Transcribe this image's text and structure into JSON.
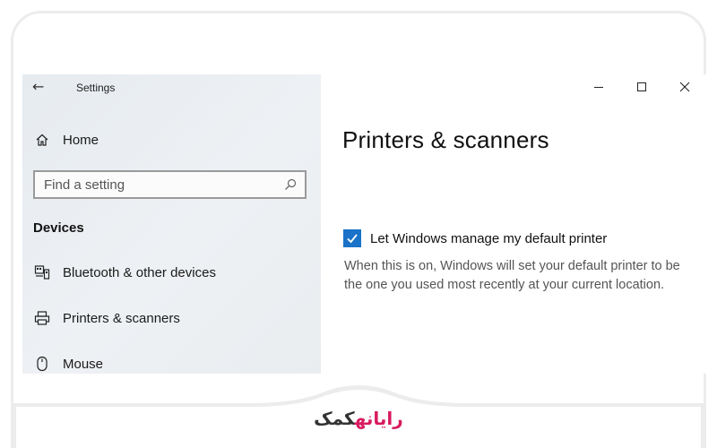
{
  "window": {
    "title": "Settings",
    "back_glyph": "←",
    "controls": [
      "minimize-icon",
      "maximize-icon",
      "close-icon"
    ]
  },
  "sidebar": {
    "home_label": "Home",
    "search_placeholder": "Find a setting",
    "section_title": "Devices",
    "items": [
      {
        "label": "Bluetooth & other devices",
        "icon": "bluetooth-devices-icon"
      },
      {
        "label": "Printers & scanners",
        "icon": "printer-icon"
      },
      {
        "label": "Mouse",
        "icon": "mouse-icon"
      }
    ]
  },
  "main": {
    "title": "Printers & scanners",
    "checkbox_label": "Let Windows manage my default printer",
    "checkbox_checked": true,
    "description": "When this is on, Windows will set your default printer to be the one you used most recently at your current location."
  },
  "brand": {
    "part1": "رایانه",
    "part2": "کمک"
  },
  "colors": {
    "accent": "#1a73c8",
    "brand_pink": "#d81b60"
  }
}
